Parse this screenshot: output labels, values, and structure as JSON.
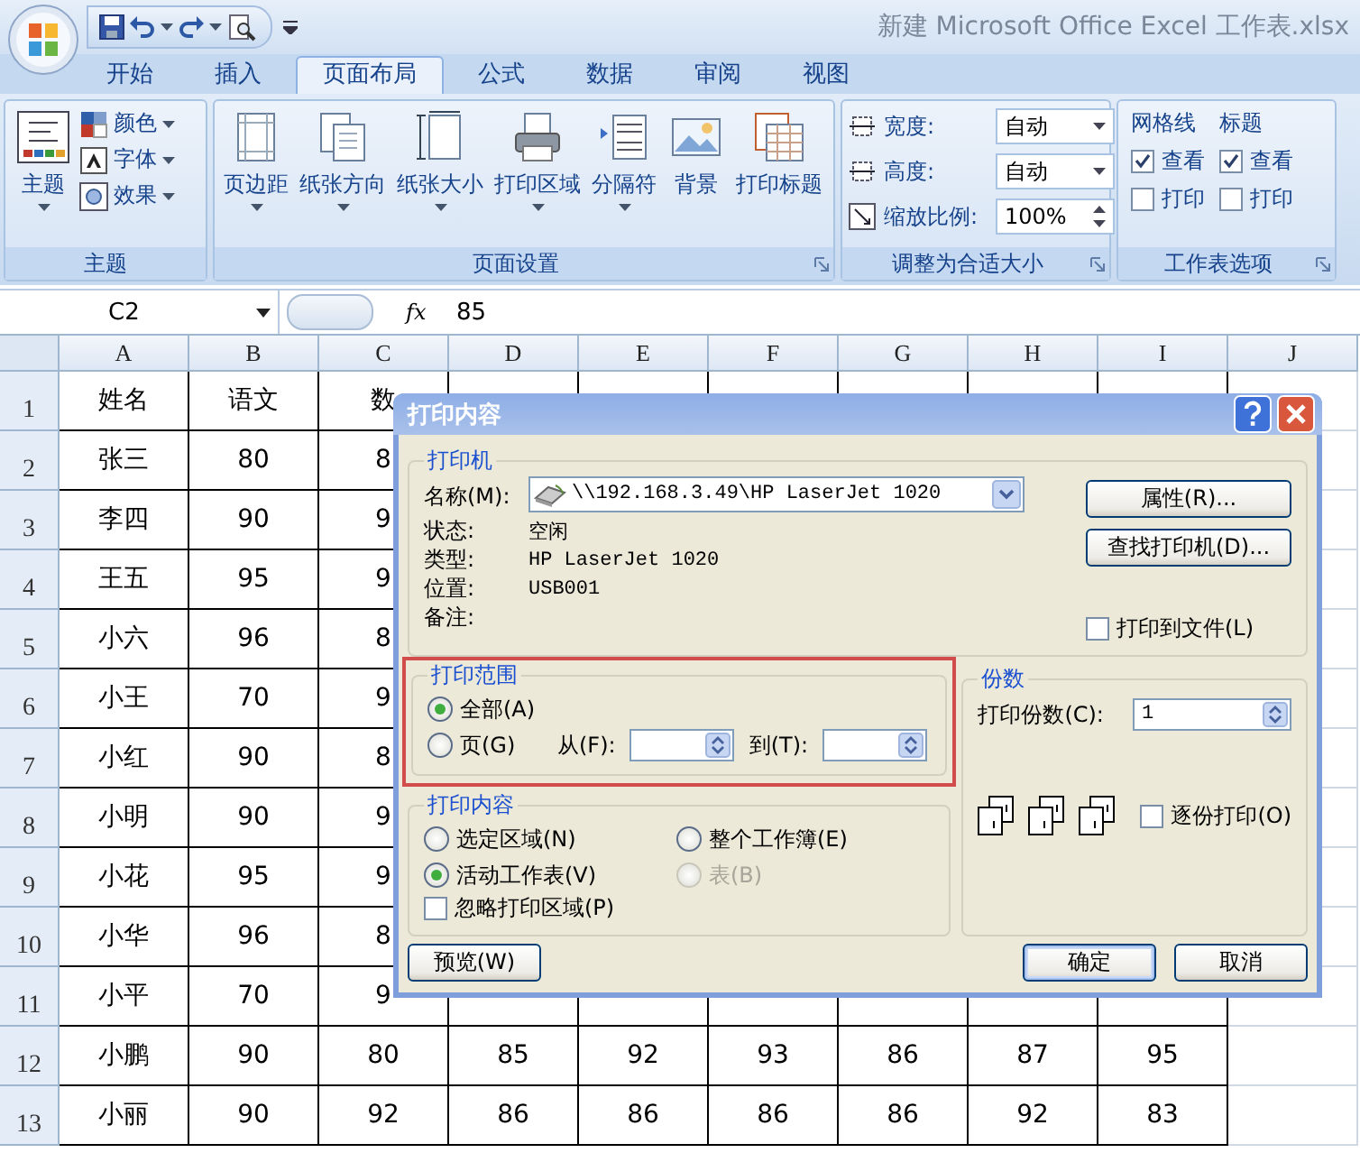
{
  "window": {
    "title": "新建 Microsoft Office Excel 工作表.xlsx"
  },
  "ribbon_tabs": [
    {
      "label": "开始",
      "selected": false
    },
    {
      "label": "插入",
      "selected": false
    },
    {
      "label": "页面布局",
      "selected": true
    },
    {
      "label": "公式",
      "selected": false
    },
    {
      "label": "数据",
      "selected": false
    },
    {
      "label": "审阅",
      "selected": false
    },
    {
      "label": "视图",
      "selected": false
    }
  ],
  "ribbon_groups": [
    {
      "kind": "theme",
      "label": "主题",
      "launcher": false,
      "large": {
        "label": "主题"
      },
      "small": [
        {
          "label": "颜色"
        },
        {
          "label": "字体"
        },
        {
          "label": "效果"
        }
      ]
    },
    {
      "kind": "buttons",
      "label": "页面设置",
      "launcher": true,
      "buttons": [
        {
          "label": "页边距",
          "dropdown": true
        },
        {
          "label": "纸张方向",
          "dropdown": true
        },
        {
          "label": "纸张大小",
          "dropdown": true
        },
        {
          "label": "打印区域",
          "dropdown": true
        },
        {
          "label": "分隔符",
          "dropdown": true
        },
        {
          "label": "背景",
          "dropdown": false
        },
        {
          "label": "打印标题",
          "dropdown": false
        }
      ]
    },
    {
      "kind": "scale",
      "label": "调整为合适大小",
      "launcher": true,
      "rows": [
        {
          "kind": "select",
          "label": "宽度:",
          "value": "自动"
        },
        {
          "kind": "select",
          "label": "高度:",
          "value": "自动"
        },
        {
          "kind": "spin",
          "label": "缩放比例:",
          "value": "100%"
        }
      ]
    },
    {
      "kind": "sheet_options",
      "label": "工作表选项",
      "launcher": true,
      "columns": [
        {
          "title": "网格线",
          "options": [
            {
              "label": "查看",
              "checked": true
            },
            {
              "label": "打印",
              "checked": false
            }
          ]
        },
        {
          "title": "标题",
          "options": [
            {
              "label": "查看",
              "checked": true
            },
            {
              "label": "打印",
              "checked": false
            }
          ]
        }
      ]
    }
  ],
  "formula_bar": {
    "name_box": "C2",
    "fx": "fx",
    "value": "85"
  },
  "sheet": {
    "columns": [
      "A",
      "B",
      "C",
      "D",
      "E",
      "F",
      "G",
      "H",
      "I",
      "J"
    ],
    "rows": [
      {
        "number": "1",
        "cells": [
          "姓名",
          "语文",
          "数"
        ]
      },
      {
        "number": "2",
        "cells": [
          "张三",
          "80",
          "8"
        ]
      },
      {
        "number": "3",
        "cells": [
          "李四",
          "90",
          "9"
        ]
      },
      {
        "number": "4",
        "cells": [
          "王五",
          "95",
          "9"
        ]
      },
      {
        "number": "5",
        "cells": [
          "小六",
          "96",
          "8"
        ]
      },
      {
        "number": "6",
        "cells": [
          "小王",
          "70",
          "9"
        ]
      },
      {
        "number": "7",
        "cells": [
          "小红",
          "90",
          "8"
        ]
      },
      {
        "number": "8",
        "cells": [
          "小明",
          "90",
          "9"
        ]
      },
      {
        "number": "9",
        "cells": [
          "小花",
          "95",
          "9"
        ]
      },
      {
        "number": "10",
        "cells": [
          "小华",
          "96",
          "8"
        ]
      },
      {
        "number": "11",
        "cells": [
          "小平",
          "70",
          "9"
        ]
      },
      {
        "number": "12",
        "cells": [
          "小鹏",
          "90",
          "80",
          "85",
          "92",
          "93",
          "86",
          "87",
          "95"
        ]
      },
      {
        "number": "13",
        "cells": [
          "小丽",
          "90",
          "92",
          "86",
          "86",
          "86",
          "86",
          "92",
          "83"
        ]
      }
    ]
  },
  "dialog": {
    "title": "打印内容",
    "printer": {
      "title": "打印机",
      "name_label": "名称(M):",
      "name": "\\\\192.168.3.49\\HP LaserJet 1020",
      "info": [
        {
          "label": "状态:",
          "value": "空闲"
        },
        {
          "label": "类型:",
          "value": "HP LaserJet 1020"
        },
        {
          "label": "位置:",
          "value": "USB001"
        },
        {
          "label": "备注:"
        }
      ],
      "buttons": [
        "属性(R)...",
        "查找打印机(D)..."
      ],
      "print_to_file": {
        "label": "打印到文件(L)",
        "checked": false
      }
    },
    "range": {
      "title": "打印范围",
      "highlighted": true,
      "options": [
        {
          "label": "全部(A)",
          "selected": true
        },
        {
          "label": "页(G)",
          "selected": false
        }
      ],
      "from_label": "从(F):",
      "to_label": "到(T):"
    },
    "print_what": {
      "title": "打印内容",
      "options": [
        {
          "label": "选定区域(N)",
          "selected": false,
          "disabled": false
        },
        {
          "label": "整个工作簿(E)",
          "selected": false,
          "disabled": false
        },
        {
          "label": "活动工作表(V)",
          "selected": true,
          "disabled": false
        },
        {
          "label": "表(B)",
          "selected": false,
          "disabled": true
        }
      ],
      "ignore_area": {
        "label": "忽略打印区域(P)",
        "checked": false
      }
    },
    "copies": {
      "title": "份数",
      "count_label": "打印份数(C):",
      "count": "1",
      "collate": {
        "label": "逐份打印(O)",
        "checked": false
      }
    },
    "buttons": [
      {
        "kind": "preview",
        "label": "预览(W)"
      },
      {
        "kind": "ok",
        "label": "确定"
      },
      {
        "kind": "cancel",
        "label": "取消"
      }
    ]
  }
}
